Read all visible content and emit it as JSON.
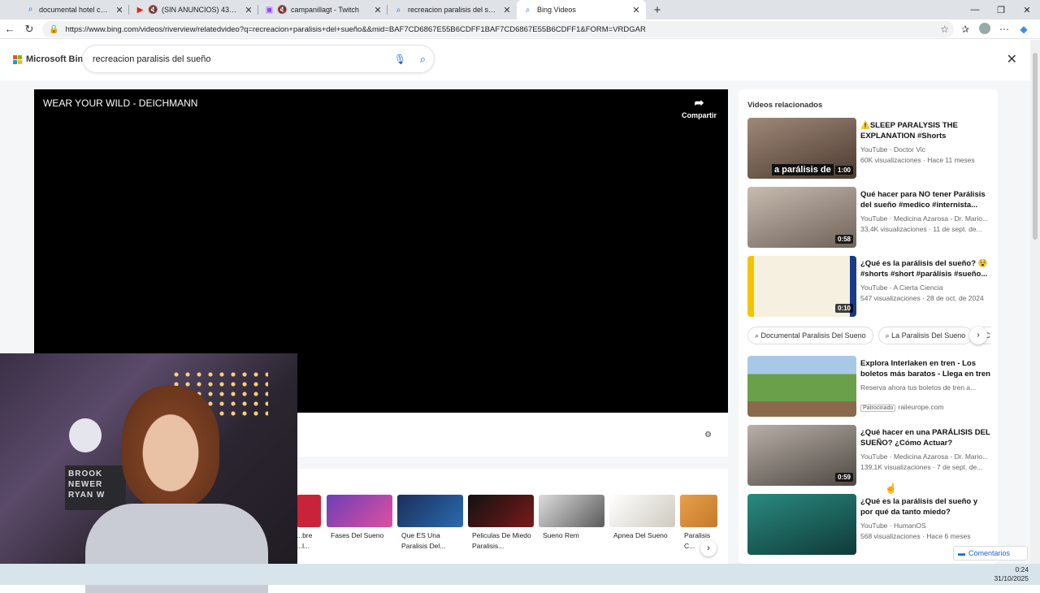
{
  "browser": {
    "tabs": [
      {
        "label": "documental hotel cecil - Búsqueda",
        "icon": "search-icon"
      },
      {
        "label": "(SIN ANUNCIOS) 432 Hz - Cura",
        "icon": "youtube-icon"
      },
      {
        "label": "campanillagt - Twitch",
        "icon": "twitch-icon"
      },
      {
        "label": "recreacion paralisis del sueño - Bing",
        "icon": "search-icon"
      },
      {
        "label": "Bing Videos",
        "icon": "search-icon"
      }
    ],
    "url": "https://www.bing.com/videos/riverview/relatedvideo?q=recreacion+paralisis+del+sueño&&mid=BAF7CD6867E55B6CDFF1BAF7CD6867E55B6CDFF1&FORM=VRDGAR"
  },
  "bing": {
    "logo": "Microsoft Bing",
    "query": "recreacion paralisis del sueño"
  },
  "player": {
    "title": "WEAR YOUR WILD - DEICHMANN",
    "share_label": "Compartir"
  },
  "strip": [
    {
      "caption": "...bre ...l...",
      "color": "#c8233a"
    },
    {
      "caption": "Fases Del Sueno",
      "color": "#6b3fb8"
    },
    {
      "caption": "Que ES Una Paralisis Del...",
      "color": "#2a6bb0"
    },
    {
      "caption": "Peliculas De Miedo Paralisis...",
      "color": "#7a1a1a"
    },
    {
      "caption": "Sueno Rem",
      "color": "#5a5a5a"
    },
    {
      "caption": "Apnea Del Sueno",
      "color": "#e8e6e0"
    },
    {
      "caption": "Paralisis C...",
      "color": "#c47a2a"
    }
  ],
  "sidebar": {
    "heading": "Videos relacionados",
    "videos": [
      {
        "title": "⚠️SLEEP PARALYSIS THE EXPLANATION #Shorts",
        "source": "YouTube · Doctor Vic",
        "stats": "60K visualizaciones · Hace 11 meses",
        "duration": "1:00",
        "overlay": "a parálisis de",
        "color": "#6a5548"
      },
      {
        "title": "Qué hacer para NO tener Parálisis del sueño #medico #internista...",
        "source": "YouTube · Medicina Azarosa - Dr. Mario...",
        "stats": "33,4K visualizaciones · 11 de sept. de...",
        "duration": "0:58",
        "color": "#9a8d80"
      },
      {
        "title": "¿Qué es la parálisis del sueño? 😵 #shorts #short #parálisis #sueño...",
        "source": "YouTube · A Cierta Ciencia",
        "stats": "547 visualizaciones · 28 de oct. de 2024",
        "duration": "0:10",
        "color": "#2a3a7a"
      },
      {
        "title": "¿Qué hacer en una PARÁLISIS DEL SUEÑO? ¿Cómo Actuar? #medico...",
        "source": "YouTube · Medicina Azarosa - Dr. Mario...",
        "stats": "139,1K visualizaciones · 7 de sept. de...",
        "duration": "0:59",
        "color": "#7d7670"
      },
      {
        "title": "¿Qué es la parálisis del sueño y por qué da tanto miedo?",
        "source": "YouTube · HumanOS",
        "stats": "568 visualizaciones · Hace 6 meses",
        "color": "#1f5a58"
      }
    ],
    "chips": [
      "Documental Paralisis Del Sueno",
      "La Paralisis Del Sueno",
      "C"
    ],
    "ad": {
      "title": "Explora Interlaken en tren - Los boletos más baratos - Llega en tren",
      "desc": "Reserva ahora tus boletos de tren a...",
      "badge": "Patrocinado",
      "domain": "raileurope.com",
      "color": "#5c9a4a"
    },
    "comments_label": "Comentarios"
  },
  "webcam": {
    "sign_text": "BROOK NEWER RYAN W"
  },
  "clock": {
    "time": "0:24",
    "date": "31/10/2025"
  }
}
